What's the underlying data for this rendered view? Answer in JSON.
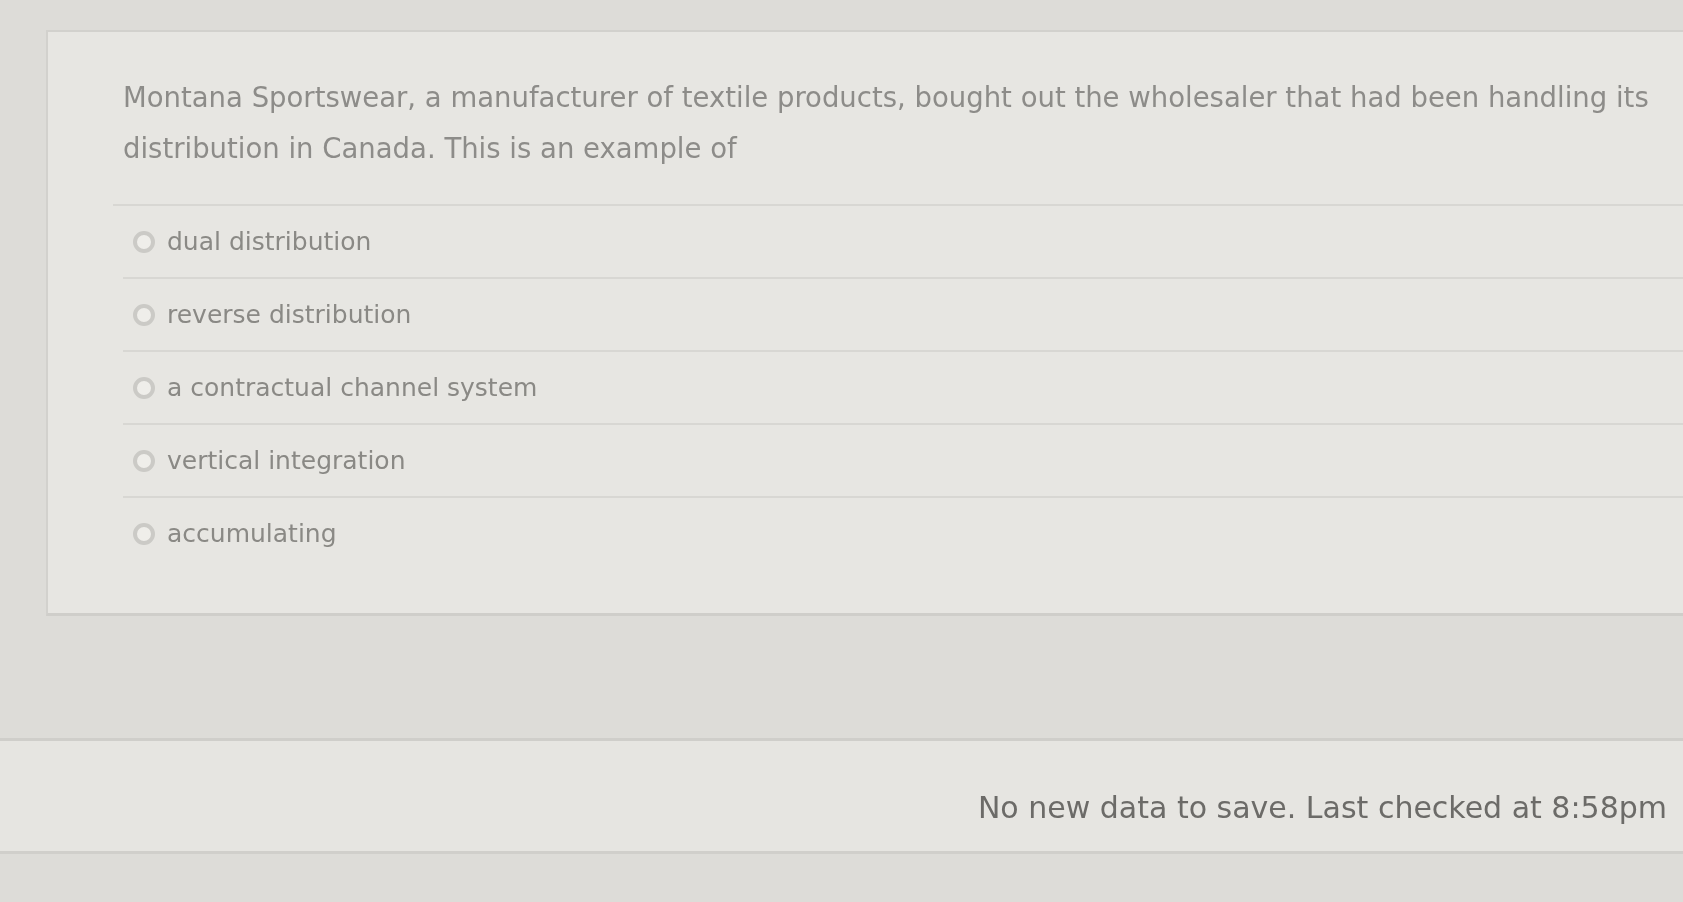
{
  "question": {
    "text": "Montana Sportswear, a manufacturer of textile products, bought out the wholesaler that had been handling its distribution in Canada. This is an example of"
  },
  "options": [
    {
      "label": "dual distribution",
      "selected": false
    },
    {
      "label": "reverse distribution",
      "selected": false
    },
    {
      "label": "a contractual channel system",
      "selected": false
    },
    {
      "label": "vertical integration",
      "selected": false
    },
    {
      "label": "accumulating",
      "selected": false
    }
  ],
  "status_bar": {
    "text": "No new data to save. Last checked at 8:58pm"
  }
}
